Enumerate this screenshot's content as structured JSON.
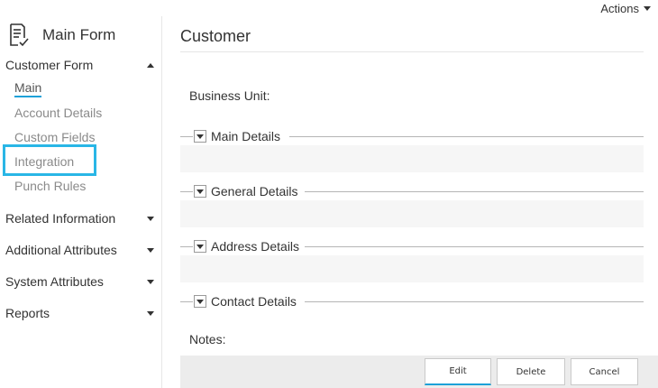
{
  "header": {
    "actions_label": "Actions"
  },
  "sidebar": {
    "form_title": "Main Form",
    "sections": [
      {
        "label": "Customer Form",
        "expanded": true
      },
      {
        "label": "Related Information",
        "expanded": false
      },
      {
        "label": "Additional Attributes",
        "expanded": false
      },
      {
        "label": "System Attributes",
        "expanded": false
      },
      {
        "label": "Reports",
        "expanded": false
      }
    ],
    "items": [
      {
        "label": "Main",
        "active": true
      },
      {
        "label": "Account Details"
      },
      {
        "label": "Custom Fields"
      },
      {
        "label": "Integration",
        "highlighted": true
      },
      {
        "label": "Punch Rules"
      }
    ]
  },
  "main": {
    "title": "Customer",
    "business_unit_label": "Business Unit:",
    "sections": [
      "Main Details",
      "General Details",
      "Address Details",
      "Contact Details"
    ],
    "notes_label": "Notes:"
  },
  "footer": {
    "edit_label": "Edit",
    "delete_label": "Delete",
    "cancel_label": "Cancel"
  },
  "colors": {
    "accent": "#1da1d8",
    "highlight": "#29b6e6",
    "band": "#f6f6f6",
    "footer": "#ececec"
  }
}
